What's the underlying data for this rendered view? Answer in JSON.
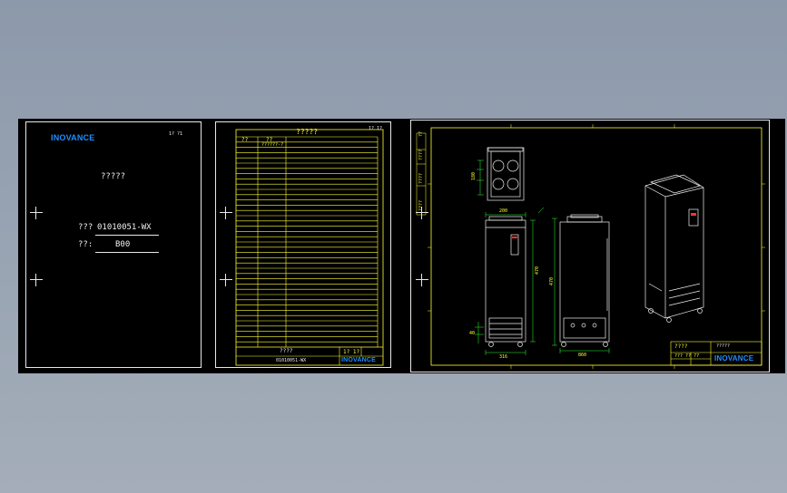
{
  "cover": {
    "brand": "INOVANCE",
    "corner_text": "1? ?1",
    "title": "?????",
    "part_label": "???",
    "part_value": "01010051-WX",
    "ver_label": "??:",
    "ver_value": "B00"
  },
  "revision": {
    "title": "?????",
    "page": "1? 1?",
    "col1": "??",
    "col2": "??",
    "first_row_text": "??????-?",
    "footer_label": "????",
    "footer_code": "01010051-WX",
    "footer_page": "1? 1?",
    "brand": "INOVANCE"
  },
  "drawing": {
    "side_labels": [
      "??",
      "????",
      "????",
      "????"
    ],
    "dim_texts": [
      "200",
      "470",
      "316",
      "470",
      "860",
      "180",
      "40"
    ],
    "tb_title": "????",
    "tb_sub": "?????",
    "tb_code": "??? ?? ??",
    "brand": "INOVANCE"
  },
  "colors": {
    "background": "#000000",
    "frame": "#ffff33",
    "linework": "#f0f0f0",
    "dimension": "#33ff33",
    "brand": "#1e90ff",
    "accent": "#ff3333"
  }
}
